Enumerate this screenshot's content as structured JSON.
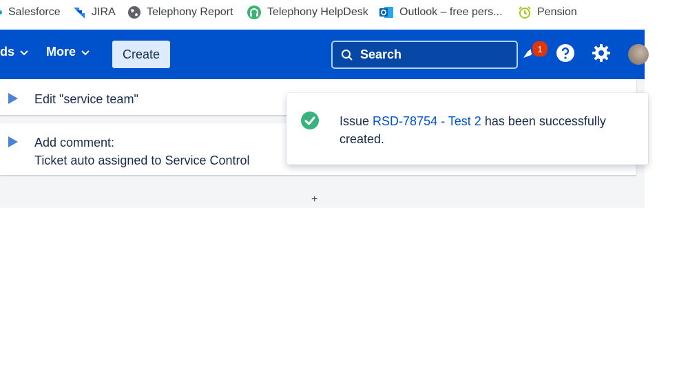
{
  "bookmarks": [
    {
      "label": "Salesforce",
      "icon": "salesforce-icon"
    },
    {
      "label": "JIRA",
      "icon": "jira-icon"
    },
    {
      "label": "Telephony Report",
      "icon": "globe-icon"
    },
    {
      "label": "Telephony HelpDesk",
      "icon": "headset-icon"
    },
    {
      "label": "Outlook – free pers...",
      "icon": "outlook-icon"
    },
    {
      "label": "Pension",
      "icon": "alarm-clock-icon"
    }
  ],
  "nav": {
    "dashboards_partial": "ds",
    "more_label": "More",
    "create_label": "Create",
    "search_placeholder": "Search",
    "notifications_count": "1",
    "brand_color": "#0052cc"
  },
  "activity": [
    {
      "line1": "Edit \"service team\""
    },
    {
      "line1": "Add comment:",
      "line2": "Ticket auto assigned to Service Control"
    }
  ],
  "add_label": "+",
  "flag": {
    "prefix": "Issue",
    "link": "RSD-78754 - Test 2",
    "suffix": "has been successfully created.",
    "status_color": "#36b37e"
  }
}
